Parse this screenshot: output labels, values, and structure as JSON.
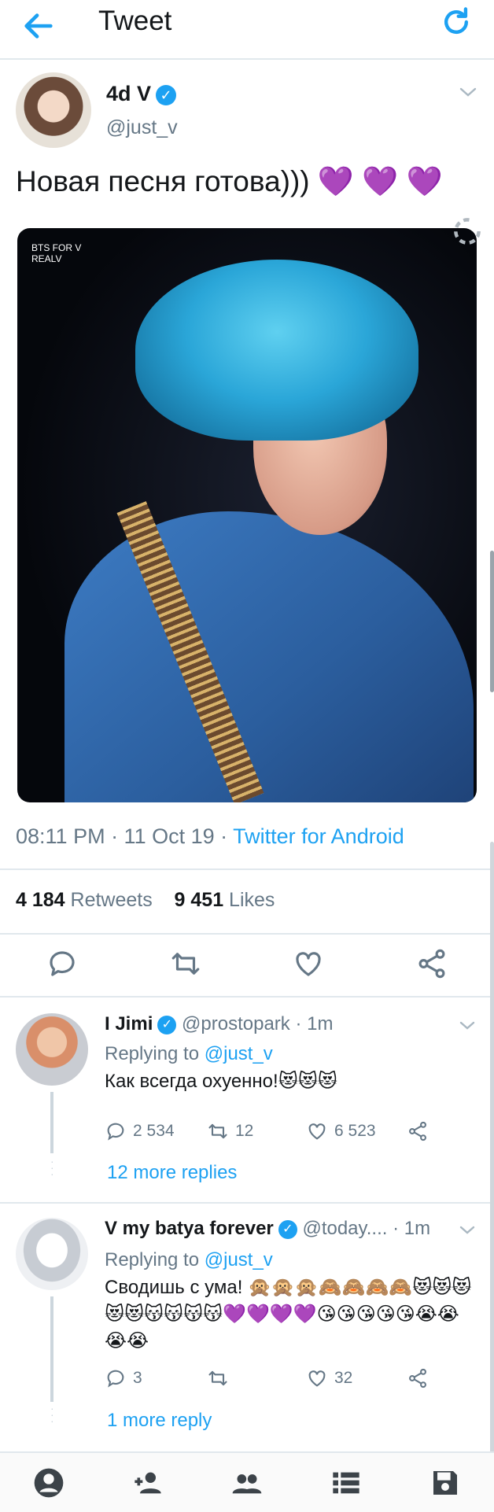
{
  "header": {
    "title": "Tweet"
  },
  "tweet": {
    "display_name": "4d V",
    "handle": "@just_v",
    "text": "Новая песня готова)))",
    "hearts": "💜 💜 💜",
    "time": "08:11 PM · 11 Oct 19 · ",
    "source": "Twitter for Android",
    "retweets_count": "4 184",
    "retweets_label": "Retweets",
    "likes_count": "9 451",
    "likes_label": "Likes",
    "image_watermark": "BTS FOR V REALV"
  },
  "replies": [
    {
      "display_name": "I Jimi",
      "handle": "@prostopark · 1m",
      "replying_prefix": "Replying to ",
      "replying_to": "@just_v",
      "text": "Как всегда охуенно!😻😻😻",
      "reply_count": "2 534",
      "retweet_count": "12",
      "like_count": "6 523",
      "more": "12 more replies"
    },
    {
      "display_name": "V my batya forever",
      "handle": "@today.... · 1m",
      "replying_prefix": "Replying to ",
      "replying_to": "@just_v",
      "text": "Сводишь с ума! 🙊🙊🙊🙈🙈🙈🙈😻😻😻😻😻😽😽😽😽💜💜💜💜😘😘😘😘😘😭😭😭😭",
      "reply_count": "3",
      "retweet_count": "",
      "like_count": "32",
      "more": "1 more reply"
    }
  ],
  "colors": {
    "accent": "#1da1f2",
    "text": "#14171a",
    "muted": "#657786",
    "divider": "#e1e8ed"
  },
  "icons": {
    "header": [
      "back-arrow-icon",
      "refresh-icon"
    ],
    "tweet_actions": [
      "reply-icon",
      "retweet-icon",
      "like-icon",
      "share-icon"
    ],
    "bottom_nav": [
      "profile-icon",
      "follow-icon",
      "people-icon",
      "list-icon",
      "save-icon"
    ]
  }
}
